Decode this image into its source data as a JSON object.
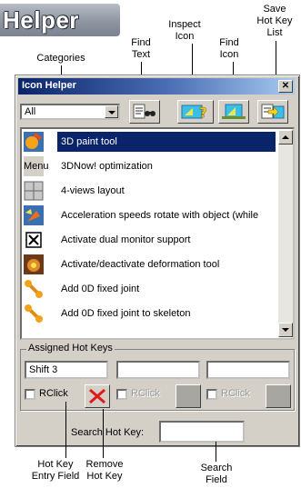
{
  "banner": {
    "text": "Helper"
  },
  "callouts": {
    "categories": "Categories",
    "find_text": "Find\nText",
    "inspect_icon": "Inspect\nIcon",
    "find_icon": "Find\nIcon",
    "save_list": "Save\nHot Key\nList",
    "entry_field": "Hot Key\nEntry Field",
    "remove_hotkey": "Remove\nHot Key",
    "search_field": "Search\nField"
  },
  "window": {
    "title": "Icon Helper",
    "close_glyph": "✕",
    "category": {
      "selected": "All"
    },
    "toolbar": {
      "find_text_icon": "find-text-icon",
      "inspect_icon": "inspect-icon",
      "find_icon": "find-icon",
      "save_icon": "save-list-icon"
    },
    "list": {
      "items": [
        {
          "icon": "paint-3d-icon",
          "label": "3D paint tool",
          "selected": true
        },
        {
          "icon": "menu-text-icon",
          "icon_text": "Menu",
          "label": "3DNow! optimization",
          "selected": false
        },
        {
          "icon": "four-views-icon",
          "label": "4-views layout",
          "selected": false
        },
        {
          "icon": "rotate-speed-icon",
          "label": "Acceleration speeds rotate with object (while",
          "selected": false
        },
        {
          "icon": "dual-monitor-icon",
          "label": "Activate dual monitor support",
          "selected": false
        },
        {
          "icon": "deformation-icon",
          "label": "Activate/deactivate deformation tool",
          "selected": false
        },
        {
          "icon": "fixed-joint-icon",
          "label": "Add 0D fixed joint",
          "selected": false
        },
        {
          "icon": "fixed-joint-skeleton-icon",
          "label": "Add 0D fixed joint to skeleton",
          "selected": false
        }
      ]
    },
    "hotkeys": {
      "group_title": "Assigned Hot Keys",
      "fields": [
        "Shift 3",
        "",
        ""
      ],
      "rclick_label": "RClick"
    },
    "search": {
      "label": "Search Hot Key:",
      "value": ""
    }
  },
  "colors": {
    "selection": "#0a246a",
    "titlebar_start": "#0a246a",
    "titlebar_end": "#a6caf0",
    "dialog_bg": "#d4d0c8"
  }
}
